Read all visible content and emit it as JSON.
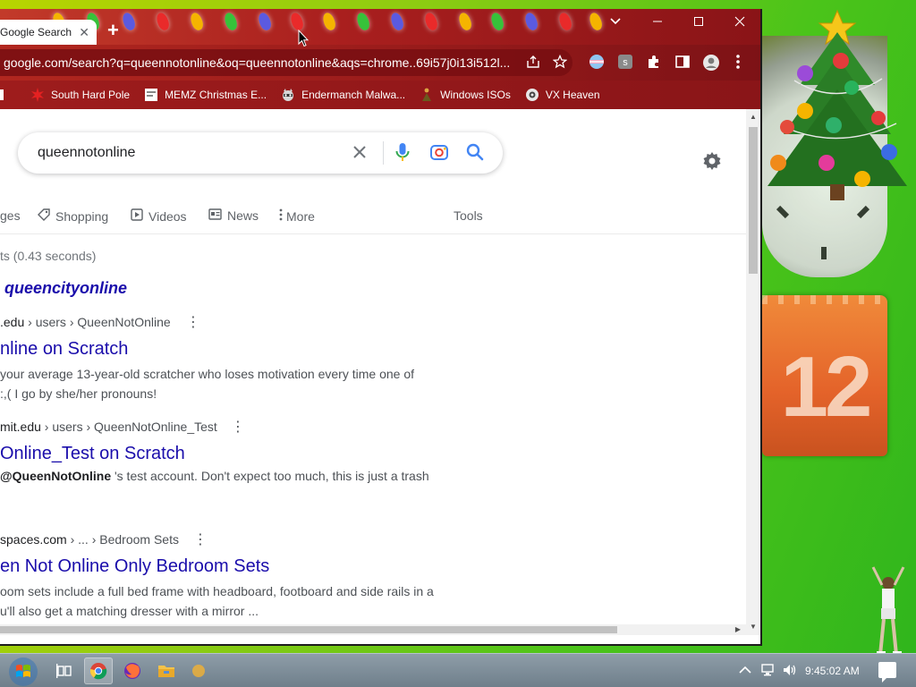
{
  "browser": {
    "tab_title": "Google Search",
    "address": "google.com/search?q=queennotonline&oq=queennotonline&aqs=chrome..69i57j0i13i512l...",
    "bookmarks": [
      {
        "label": "South Hard Pole",
        "icon": "burst-icon"
      },
      {
        "label": "MEMZ Christmas E...",
        "icon": "page-icon"
      },
      {
        "label": "Endermanch Malwa...",
        "icon": "raccoon-icon"
      },
      {
        "label": "Windows ISOs",
        "icon": "figure-icon"
      },
      {
        "label": "VX Heaven",
        "icon": "gear-badge-icon"
      }
    ]
  },
  "search": {
    "query": "queennotonline",
    "tabs": [
      "ges",
      "Shopping",
      "Videos",
      "News",
      "More"
    ],
    "tools": "Tools",
    "stats": "ts (0.43 seconds)",
    "did_you_mean": "queencityonline",
    "results": [
      {
        "cite_domain": ".edu",
        "cite_path": " › users › QueenNotOnline",
        "title": "nline on Scratch",
        "snippet_lines": [
          "your average 13-year-old scratcher who loses motivation every time one of",
          ":,( I go by she/her pronouns!"
        ]
      },
      {
        "cite_domain": "mit.edu",
        "cite_path": " › users › QueenNotOnline_Test",
        "title": "Online_Test on Scratch",
        "snippet_bold": "@QueenNotOnline",
        "snippet_rest": " 's test account. Don't expect too much, this is just a trash"
      },
      {
        "cite_domain": "spaces.com",
        "cite_path": " › ... › Bedroom Sets",
        "title": "en Not Online Only Bedroom Sets",
        "snippet_lines": [
          "oom sets include a full bed frame with headboard, footboard and side rails in a",
          "u'll also get a matching dresser with a mirror ..."
        ]
      }
    ]
  },
  "desktop": {
    "calendar_day": "12"
  },
  "taskbar": {
    "time": "9:45:02 AM"
  },
  "colors": {
    "link": "#1a0dab",
    "chrome_red": "#a91f1e"
  }
}
